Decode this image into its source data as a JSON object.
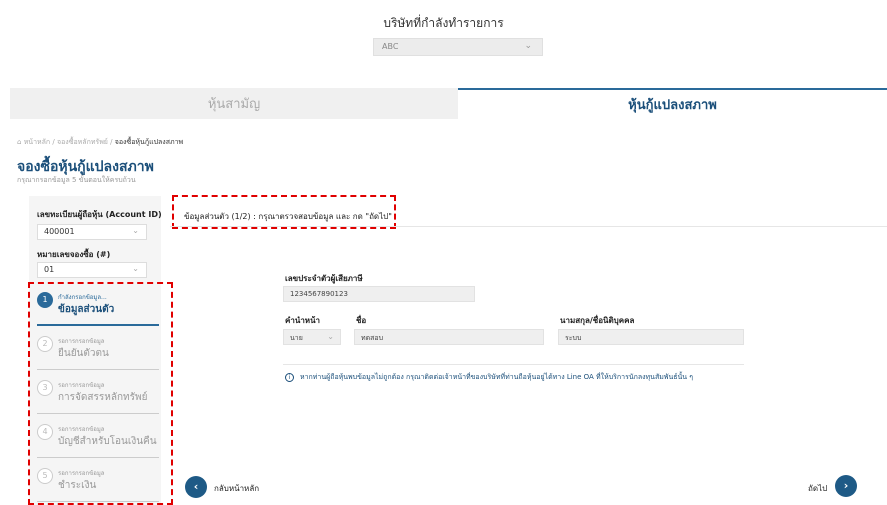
{
  "header": {
    "company_label": "บริษัทที่กำลังทำรายการ",
    "company_value": "ABC"
  },
  "tabs": [
    {
      "label": "หุ้นสามัญ",
      "active": false
    },
    {
      "label": "หุ้นกู้แปลงสภาพ",
      "active": true
    }
  ],
  "breadcrumb": {
    "home": "หน้าหลัก",
    "sep": "/",
    "mid": "จองซื้อหลักทรัพย์",
    "current": "จองซื้อหุ้นกู้แปลงสภาพ"
  },
  "page": {
    "title": "จองซื้อหุ้นกู้แปลงสภาพ",
    "subtitle": "กรุณากรอกข้อมูล 5 ขั้นตอนให้ครบถ้วน"
  },
  "sidebar": {
    "account_label": "เลขทะเบียนผู้ถือหุ้น (Account ID)",
    "account_value": "400001",
    "booking_label": "หมายเลขจองซื้อ (#)",
    "booking_value": "01",
    "steps": [
      {
        "num": "1",
        "status": "กำลังกรอกข้อมูล...",
        "name": "ข้อมูลส่วนตัว"
      },
      {
        "num": "2",
        "status": "รอการกรอกข้อมูล",
        "name": "ยืนยันตัวตน"
      },
      {
        "num": "3",
        "status": "รอการกรอกข้อมูล",
        "name": "การจัดสรรหลักทรัพย์"
      },
      {
        "num": "4",
        "status": "รอการกรอกข้อมูล",
        "name": "บัญชีสำหรับโอนเงินคืน"
      },
      {
        "num": "5",
        "status": "รอการกรอกข้อมูล",
        "name": "ชำระเงิน"
      }
    ]
  },
  "form": {
    "section_header": "ข้อมูลส่วนตัว (1/2) : กรุณาตรวจสอบข้อมูล และ กด \"ถัดไป\"",
    "tax_id_label": "เลขประจำตัวผู้เสียภาษี",
    "tax_id_value": "1234567890123",
    "prefix_label": "คำนำหน้า",
    "prefix_value": "นาย",
    "first_name_label": "ชื่อ",
    "first_name_value": "ทดสอบ",
    "last_name_label": "นามสกุล/ชื่อนิติบุคคล",
    "last_name_value": "ระบบ",
    "notice": "หากท่านผู้ถือหุ้นพบข้อมูลไม่ถูกต้อง กรุณาติดต่อเจ้าหน้าที่ของบริษัทที่ท่านถือหุ้นอยู่ได้ทาง Line OA ที่ให้บริการนักลงทุนสัมพันธ์นั้น ๆ"
  },
  "footer": {
    "back_label": "กลับหน้าหลัก",
    "next_label": "ถัดไป"
  },
  "colors": {
    "primary": "#1b4f7a",
    "button": "#1e5a86",
    "highlight": "#e00000"
  }
}
